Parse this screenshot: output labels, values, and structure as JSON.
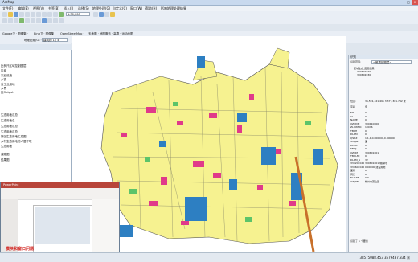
{
  "window": {
    "title": "ArcMap"
  },
  "menu": {
    "items": [
      "文件(F)",
      "编辑(E)",
      "视图(V)",
      "书签(B)",
      "插入(I)",
      "选择(S)",
      "地理处理(G)",
      "自定义(C)",
      "窗口(W)",
      "帮助(H)",
      "影响地理处理结果"
    ]
  },
  "toolbar": {
    "scale": "1:30,000",
    "google_label": "Google卫 · 图像集 ·",
    "bing_label": "Bing卫 · 图像集 ·",
    "osm_label": "OpenStreetMap ·",
    "extra_label": "天地图 · 地图服务 · 高德 · 运动地图",
    "layer_label": "地理配准(G) ·",
    "layer_value": "建筑物 1 / 4",
    "editor_label": "编辑器(R) ·"
  },
  "left_panel": {
    "items": [
      "比例尺区域控制图层",
      "区域",
      "农业设施",
      "乡镇",
      "对工业用地",
      "乡界",
      "区Output",
      "生态用地汇总",
      "生态用地总",
      "生态用地汇总",
      "生态用地汇总",
      "新区生态用地汇总图",
      "乡村生态用地的人居环境",
      "生态用地",
      "道路图",
      "结果图"
    ]
  },
  "identify": {
    "title": "识别",
    "header_label": "识别范围:",
    "header_value": "<最顶部图层>",
    "tree": [
      "区域生态_图层结果",
      "330602020",
      "330602030"
    ],
    "location_label": "位置:",
    "location_value": "36,591,321.491  3,377,301.792 米",
    "field_header": "字段",
    "value_header": "值",
    "rows": [
      {
        "field": "FID",
        "value": "0"
      },
      {
        "field": "Id",
        "value": "0"
      },
      {
        "field": "NAME",
        "value": "0"
      },
      {
        "field": "XZQDM",
        "value": "330110000"
      },
      {
        "field": "ZLDWMC",
        "value": "13076"
      },
      {
        "field": "TBBH",
        "value": "0"
      },
      {
        "field": "DLBM",
        "value": "0"
      },
      {
        "field": "QSXZ",
        "value": "1,1,1,0.000000,0.000000"
      },
      {
        "field": "Shape",
        "value": "面"
      },
      {
        "field": "DLMC",
        "value": "0"
      },
      {
        "field": "TBMJ",
        "value": "0"
      },
      {
        "field": "XZDM",
        "value": "330601001"
      },
      {
        "field": "TBDLMJ",
        "value": "0"
      },
      {
        "field": "DLBM_1",
        "value": "32"
      },
      {
        "field": "330202020",
        "value": "330601001  城镇村"
      },
      {
        "field": "330602020",
        "value": "0.00000  建设用地"
      },
      {
        "field": "面积",
        "value": "0"
      },
      {
        "field": "周长",
        "value": "0"
      },
      {
        "field": "ELEVM",
        "value": "0.0"
      },
      {
        "field": "XZQMC",
        "value": "杭州市萧山区"
      }
    ],
    "footer": "识别了 1 个要素"
  },
  "status": {
    "coords": "38575088.453  3579437.834 米"
  },
  "popup": {
    "title": "PowerPoint",
    "caption": "模块和窗口问题"
  }
}
